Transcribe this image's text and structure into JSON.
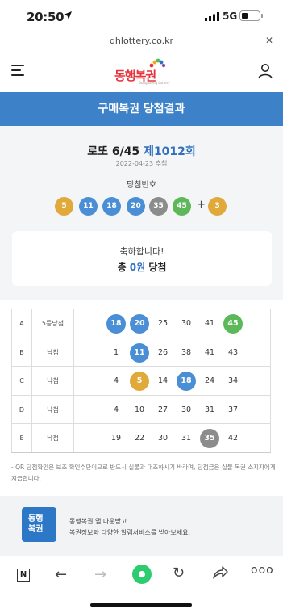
{
  "status": {
    "time": "20:50",
    "network": "5G"
  },
  "browser": {
    "url": "dhlottery.co.kr"
  },
  "header": {
    "logo": "동행복권",
    "logo_sub": "Donghaeng Lottery"
  },
  "page_title": "구매복권 당첨결과",
  "draw": {
    "game_name": "로또 6/45",
    "round": "제1012회",
    "date": "2022-04-23 추첨",
    "win_label": "당첨번호",
    "numbers": [
      5,
      11,
      18,
      20,
      35,
      45
    ],
    "bonus": 3,
    "plus": "+"
  },
  "congrats": {
    "line1": "축하합니다!",
    "prefix": "총 ",
    "amount": "0원",
    "suffix": " 당첨"
  },
  "ball_colors": {
    "yellow": "#e0a93a",
    "blue": "#4a8fd6",
    "gray": "#8c8c8c",
    "green": "#5db85a"
  },
  "tickets": [
    {
      "game": "A",
      "result": "5등당첨",
      "numbers": [
        18,
        20,
        25,
        30,
        41,
        45
      ]
    },
    {
      "game": "B",
      "result": "낙첨",
      "numbers": [
        1,
        11,
        26,
        38,
        41,
        43
      ]
    },
    {
      "game": "C",
      "result": "낙첨",
      "numbers": [
        4,
        5,
        14,
        18,
        24,
        34
      ]
    },
    {
      "game": "D",
      "result": "낙첨",
      "numbers": [
        4,
        10,
        27,
        30,
        31,
        37
      ]
    },
    {
      "game": "E",
      "result": "낙첨",
      "numbers": [
        19,
        22,
        30,
        31,
        35,
        42
      ]
    }
  ],
  "notice": "- QR 당첨확인은 보조 확인수단이므로 반드시 실물과 대조하시기 바라며, 당첨금은 실물 복권 소지자에게 지급합니다.",
  "app_banner": {
    "icon_text": "동행\n복권",
    "line1": "동행복권 앱 다운받고",
    "line2": "복권정보와 다양한 알림서비스를 받아보세요."
  },
  "toolbar": {
    "n_label": "N",
    "more": "ooo"
  }
}
